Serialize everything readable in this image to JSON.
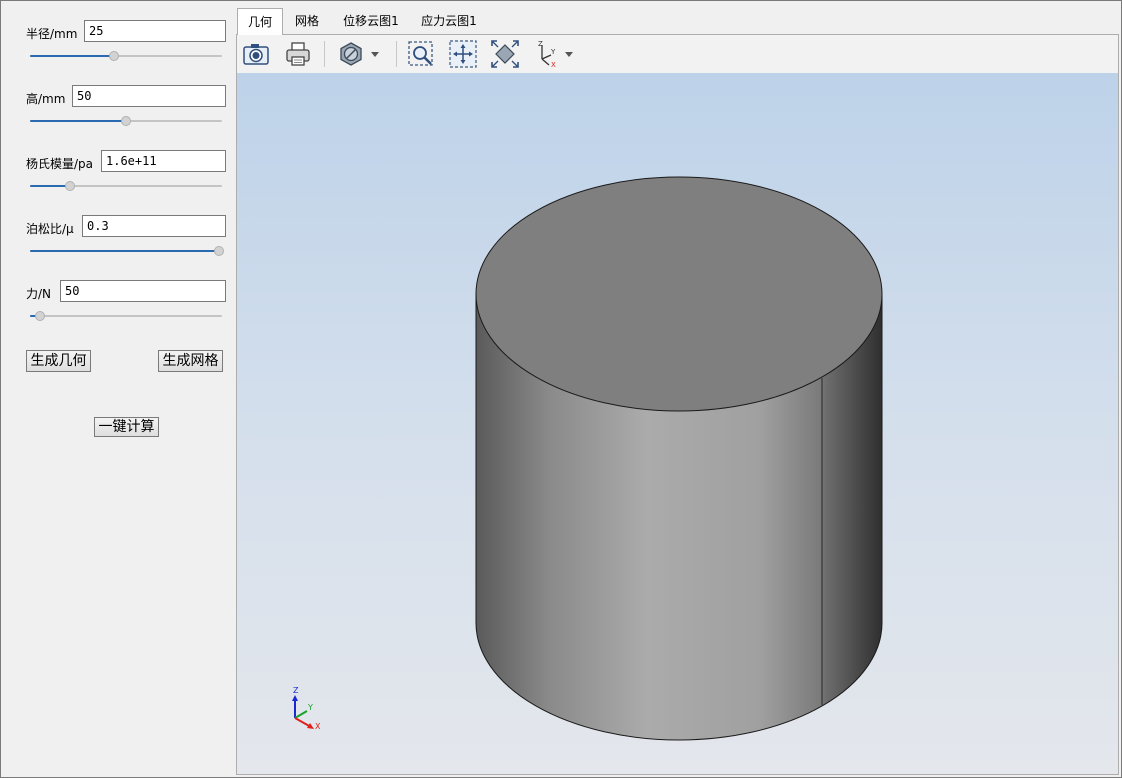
{
  "params": {
    "radius": {
      "label": "半径/mm",
      "value": "25",
      "slider_fraction": 0.44
    },
    "height": {
      "label": "高/mm",
      "value": "50",
      "slider_fraction": 0.5
    },
    "youngs": {
      "label": "杨氏模量/pa",
      "value": "1.6e+11",
      "slider_fraction": 0.21
    },
    "poisson": {
      "label": "泊松比/μ",
      "value": "0.3",
      "slider_fraction": 1.0
    },
    "force": {
      "label": "力/N",
      "value": "50",
      "slider_fraction": 0.05
    }
  },
  "buttons": {
    "generate_geometry": "生成几何",
    "generate_mesh": "生成网格",
    "compute": "一键计算"
  },
  "tabs": [
    {
      "label": "几何",
      "active": true
    },
    {
      "label": "网格",
      "active": false
    },
    {
      "label": "位移云图1",
      "active": false
    },
    {
      "label": "应力云图1",
      "active": false
    }
  ],
  "toolbar": {
    "icons": [
      "camera-icon",
      "printer-icon",
      "display-mode-icon",
      "zoom-window-icon",
      "pan-icon",
      "fit-all-icon",
      "axes-view-icon"
    ]
  },
  "triad": {
    "x": "X",
    "y": "Y",
    "z": "Z"
  },
  "colors": {
    "accent": "#2a6ab0",
    "axis_x": "#e0201a",
    "axis_y": "#1aa02a",
    "axis_z": "#1a2ad0"
  }
}
